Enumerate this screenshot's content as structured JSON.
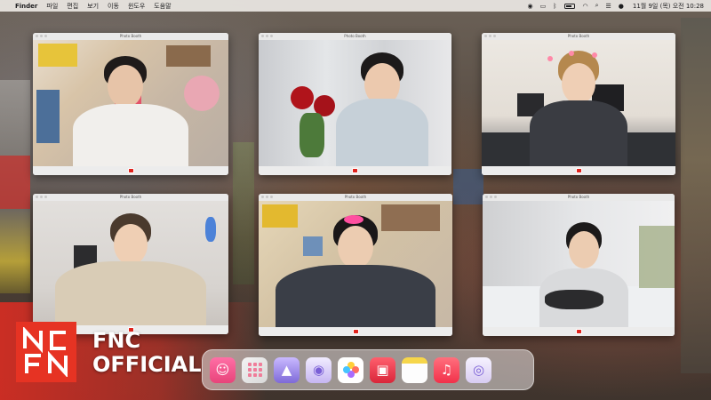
{
  "menubar": {
    "app_name": "Finder",
    "menus": [
      "파일",
      "편집",
      "보기",
      "이동",
      "윈도우",
      "도움말"
    ],
    "clock": "11월 9일 (목) 오전 10:28"
  },
  "windows": [
    {
      "title": "Photo Booth"
    },
    {
      "title": "Photo Booth"
    },
    {
      "title": "Photo Booth"
    },
    {
      "title": "Photo Booth"
    },
    {
      "title": "Photo Booth"
    },
    {
      "title": "Photo Booth"
    }
  ],
  "branding": {
    "line1": "FNC",
    "line2": "OFFICIAL",
    "logo_letters": "NCFN",
    "color": "#e63323"
  },
  "dock": {
    "icons": [
      "finder-icon",
      "launchpad-icon",
      "app-icon",
      "app-icon",
      "photos-icon",
      "photo-booth-icon",
      "notes-icon",
      "music-icon",
      "quicktime-icon"
    ]
  }
}
